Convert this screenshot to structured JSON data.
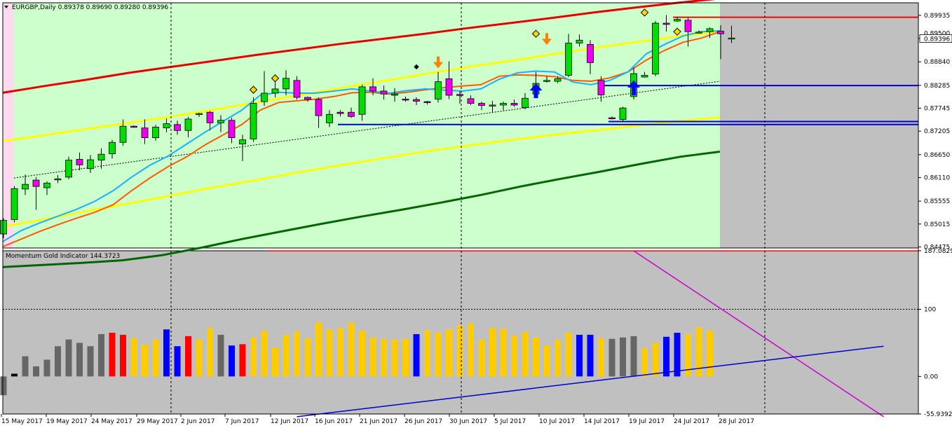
{
  "window": {
    "main_title": "EURGBP,Daily  0.89378 0.89690 0.89280 0.89396",
    "indicator_title": "Momentum Gold Indicator 144.3723",
    "current_price_label": "0.89396",
    "hidden_price_label": "0.89500"
  },
  "colors": {
    "bull": "#00dd00",
    "bear": "#ee00ee",
    "chart_bg": "#ccffcc",
    "future_bg": "#c0c0c0",
    "band": "#e60000",
    "yellow": "#ffff00",
    "green_ma": "#006600",
    "blue_level": "#0000cc",
    "red_level": "#ff0000",
    "ema_fast": "#1ab0ff",
    "ema_slow": "#ff5a00"
  },
  "chart_data": [
    {
      "type": "candlestick",
      "title": "EURGBP,Daily",
      "ylim": [
        0.8445,
        0.9023
      ],
      "y_ticks": [
        "0.89935",
        "0.89390",
        "0.88840",
        "0.88285",
        "0.87745",
        "0.87205",
        "0.86650",
        "0.86110",
        "0.85555",
        "0.85015",
        "0.84475"
      ],
      "x_ticks": [
        "15 May 2017",
        "19 May 2017",
        "24 May 2017",
        "29 May 2017",
        "2 Jun 2017",
        "7 Jun 2017",
        "12 Jun 2017",
        "16 Jun 2017",
        "21 Jun 2017",
        "26 Jun 2017",
        "30 Jun 2017",
        "5 Jul 2017",
        "10 Jul 2017",
        "14 Jul 2017",
        "19 Jul 2017",
        "24 Jul 2017",
        "28 Jul 2017"
      ],
      "ohlc": [
        [
          0.8478,
          0.8515,
          0.8468,
          0.851
        ],
        [
          0.8512,
          0.8591,
          0.8505,
          0.8585
        ],
        [
          0.8584,
          0.8618,
          0.857,
          0.8595
        ],
        [
          0.8605,
          0.8612,
          0.8535,
          0.859
        ],
        [
          0.8587,
          0.8602,
          0.857,
          0.8598
        ],
        [
          0.8608,
          0.8617,
          0.8598,
          0.8608
        ],
        [
          0.8612,
          0.866,
          0.8607,
          0.8652
        ],
        [
          0.8654,
          0.867,
          0.8628,
          0.8641
        ],
        [
          0.8632,
          0.8664,
          0.8622,
          0.8653
        ],
        [
          0.8652,
          0.868,
          0.8632,
          0.8666
        ],
        [
          0.8667,
          0.87,
          0.8656,
          0.8694
        ],
        [
          0.8694,
          0.8748,
          0.8686,
          0.8732
        ],
        [
          0.8732,
          0.8734,
          0.8728,
          0.873
        ],
        [
          0.8728,
          0.8748,
          0.869,
          0.8705
        ],
        [
          0.8705,
          0.8735,
          0.8698,
          0.873
        ],
        [
          0.8728,
          0.875,
          0.8718,
          0.8738
        ],
        [
          0.8736,
          0.8745,
          0.8712,
          0.8722
        ],
        [
          0.8722,
          0.8754,
          0.8706,
          0.8749
        ],
        [
          0.876,
          0.8764,
          0.8754,
          0.8762
        ],
        [
          0.8765,
          0.8768,
          0.8722,
          0.874
        ],
        [
          0.874,
          0.8758,
          0.8718,
          0.8746
        ],
        [
          0.8746,
          0.8752,
          0.8692,
          0.8705
        ],
        [
          0.869,
          0.8712,
          0.865,
          0.87
        ],
        [
          0.8702,
          0.88,
          0.8695,
          0.8786
        ],
        [
          0.879,
          0.8862,
          0.878,
          0.881
        ],
        [
          0.881,
          0.8852,
          0.88,
          0.882
        ],
        [
          0.882,
          0.8864,
          0.8805,
          0.8845
        ],
        [
          0.884,
          0.885,
          0.8795,
          0.88
        ],
        [
          0.88,
          0.8802,
          0.879,
          0.8795
        ],
        [
          0.8795,
          0.88,
          0.8728,
          0.8757
        ],
        [
          0.874,
          0.877,
          0.873,
          0.876
        ],
        [
          0.8765,
          0.877,
          0.8755,
          0.8762
        ],
        [
          0.8765,
          0.8776,
          0.8752,
          0.8755
        ],
        [
          0.876,
          0.883,
          0.8745,
          0.8825
        ],
        [
          0.8825,
          0.8845,
          0.8805,
          0.8815
        ],
        [
          0.8815,
          0.8828,
          0.8795,
          0.8808
        ],
        [
          0.8805,
          0.8822,
          0.879,
          0.8808
        ],
        [
          0.8796,
          0.8802,
          0.879,
          0.8795
        ],
        [
          0.8795,
          0.88,
          0.8782,
          0.8791
        ],
        [
          0.879,
          0.8792,
          0.8783,
          0.8788
        ],
        [
          0.8796,
          0.886,
          0.8788,
          0.8837
        ],
        [
          0.8844,
          0.8885,
          0.8796,
          0.8805
        ],
        [
          0.8807,
          0.8815,
          0.8785,
          0.8805
        ],
        [
          0.8797,
          0.8805,
          0.8782,
          0.8786
        ],
        [
          0.8786,
          0.879,
          0.877,
          0.8781
        ],
        [
          0.878,
          0.8792,
          0.8765,
          0.8782
        ],
        [
          0.8782,
          0.879,
          0.877,
          0.8786
        ],
        [
          0.8786,
          0.8795,
          0.8778,
          0.8782
        ],
        [
          0.8776,
          0.881,
          0.8772,
          0.8798
        ],
        [
          0.8808,
          0.886,
          0.88,
          0.8833
        ],
        [
          0.8838,
          0.885,
          0.8835,
          0.884
        ],
        [
          0.8838,
          0.885,
          0.8834,
          0.8844
        ],
        [
          0.8852,
          0.895,
          0.8848,
          0.8928
        ],
        [
          0.8928,
          0.8948,
          0.892,
          0.8935
        ],
        [
          0.8925,
          0.8935,
          0.8855,
          0.8882
        ],
        [
          0.884,
          0.885,
          0.879,
          0.8806
        ],
        [
          0.8752,
          0.8755,
          0.8748,
          0.8751
        ],
        [
          0.8748,
          0.8778,
          0.8742,
          0.8775
        ],
        [
          0.8802,
          0.887,
          0.8795,
          0.8856
        ],
        [
          0.8848,
          0.886,
          0.8846,
          0.8852
        ],
        [
          0.8855,
          0.898,
          0.885,
          0.8975
        ],
        [
          0.8975,
          0.8994,
          0.8955,
          0.8972
        ],
        [
          0.898,
          0.899,
          0.8978,
          0.8984
        ],
        [
          0.8982,
          0.899,
          0.892,
          0.8955
        ],
        [
          0.8952,
          0.8958,
          0.895,
          0.8954
        ],
        [
          0.8955,
          0.8965,
          0.894,
          0.8962
        ],
        [
          0.8956,
          0.897,
          0.889,
          0.895
        ],
        [
          0.8938,
          0.8969,
          0.8928,
          0.894
        ]
      ],
      "series": [
        {
          "kind": "band_upper",
          "color": "#e60000",
          "values": [
            0.8811,
            0.8827,
            0.8842,
            0.8858,
            0.8872,
            0.8886,
            0.89,
            0.8913,
            0.8926,
            0.8938,
            0.895,
            0.8963,
            0.8975,
            0.8987,
            0.9,
            0.9012,
            0.9023,
            0.9033
          ]
        },
        {
          "kind": "yellow_upper",
          "color": "#ffff00",
          "values": [
            0.8697,
            0.8711,
            0.8726,
            0.874,
            0.8755,
            0.8771,
            0.8788,
            0.8805,
            0.8822,
            0.8838,
            0.8855,
            0.8871,
            0.8886,
            0.8901,
            0.8916,
            0.893,
            0.8944,
            0.8955
          ]
        },
        {
          "kind": "yellow_lower",
          "color": "#ffff00",
          "values": [
            0.8495,
            0.8513,
            0.8532,
            0.855,
            0.8569,
            0.8588,
            0.8605,
            0.8623,
            0.864,
            0.8656,
            0.8672,
            0.8686,
            0.8699,
            0.8711,
            0.8722,
            0.8733,
            0.8744,
            0.8753
          ]
        },
        {
          "kind": "green_ma",
          "color": "#006600",
          "values": [
            0.84,
            0.8405,
            0.841,
            0.8416,
            0.8428,
            0.8446,
            0.8466,
            0.8484,
            0.8502,
            0.8519,
            0.8535,
            0.8552,
            0.857,
            0.859,
            0.8608,
            0.8625,
            0.8643,
            0.866,
            0.8672
          ]
        },
        {
          "kind": "dotted_trend",
          "color": "#000000",
          "values": [
            0.861,
            0.8838
          ]
        },
        {
          "kind": "ema_fast",
          "color": "#1ab0ff",
          "values": [
            0.846,
            0.8486,
            0.8504,
            0.852,
            0.8536,
            0.8555,
            0.858,
            0.8612,
            0.864,
            0.8662,
            0.869,
            0.8718,
            0.8744,
            0.877,
            0.8805,
            0.8812,
            0.881,
            0.881,
            0.8815,
            0.882,
            0.8815,
            0.881,
            0.8816,
            0.882,
            0.8817,
            0.8815,
            0.882,
            0.8843,
            0.8858,
            0.8862,
            0.886,
            0.8836,
            0.883,
            0.884,
            0.886,
            0.8903,
            0.8925,
            0.8945,
            0.8955,
            0.8957
          ]
        },
        {
          "kind": "ema_slow",
          "color": "#ff5a00",
          "values": [
            0.8448,
            0.8466,
            0.8484,
            0.85,
            0.8515,
            0.8529,
            0.8547,
            0.858,
            0.861,
            0.8637,
            0.866,
            0.8688,
            0.8712,
            0.8736,
            0.877,
            0.8788,
            0.8792,
            0.8796,
            0.8802,
            0.8811,
            0.8812,
            0.8808,
            0.8812,
            0.8818,
            0.8823,
            0.8827,
            0.883,
            0.885,
            0.8853,
            0.8852,
            0.8849,
            0.884,
            0.8838,
            0.8846,
            0.886,
            0.8888,
            0.8911,
            0.893,
            0.894,
            0.8955
          ]
        }
      ],
      "levels": [
        {
          "price": 0.8989,
          "color": "#ff0000"
        },
        {
          "price": 0.8828,
          "color": "#0000cc"
        },
        {
          "price": 0.8743,
          "color": "#0000cc"
        },
        {
          "price": 0.8736,
          "color": "#0000cc"
        }
      ],
      "markers": [
        {
          "kind": "diamond",
          "bar": 23,
          "price": 0.8818
        },
        {
          "kind": "diamond",
          "bar": 25,
          "price": 0.8845
        },
        {
          "kind": "diamond_small",
          "bar": 38,
          "price": 0.8872
        },
        {
          "kind": "diamond",
          "bar": 49,
          "price": 0.895
        },
        {
          "kind": "diamond",
          "bar": 59,
          "price": 0.9
        },
        {
          "kind": "diamond",
          "bar": 62,
          "price": 0.8955
        },
        {
          "kind": "arrow_down",
          "bar": 40,
          "price": 0.888
        },
        {
          "kind": "arrow_down",
          "bar": 50,
          "price": 0.8935
        },
        {
          "kind": "arrow_up",
          "bar": 49,
          "price": 0.8818
        },
        {
          "kind": "arrow_up",
          "bar": 58,
          "price": 0.8825
        }
      ]
    },
    {
      "type": "bar",
      "title": "Momentum Gold Indicator 144.3723",
      "ylim": [
        -55.9392,
        187.0829
      ],
      "y_ticks": [
        "187.0829",
        "100",
        "0.00",
        "-55.9392"
      ],
      "values": [
        -28,
        4,
        30,
        15,
        25,
        45,
        55,
        50,
        45,
        63,
        65,
        62,
        57,
        47,
        55,
        70,
        45,
        60,
        55,
        72,
        62,
        46,
        48,
        58,
        68,
        43,
        62,
        67,
        57,
        80,
        70,
        72,
        80,
        68,
        58,
        56,
        55,
        56,
        63,
        69,
        65,
        70,
        76,
        79,
        55,
        72,
        71,
        61,
        66,
        58,
        46,
        55,
        65,
        62,
        62,
        57,
        56,
        58,
        60,
        42,
        50,
        59,
        65,
        63,
        73,
        68
      ],
      "colors": [
        "gray",
        "black",
        "gray",
        "gray",
        "gray",
        "gray",
        "gray",
        "gray",
        "gray",
        "gray",
        "red",
        "red",
        "gold",
        "gold",
        "gold",
        "blue",
        "blue",
        "red",
        "gold",
        "gold",
        "gray",
        "blue",
        "red",
        "gold",
        "gold",
        "gold",
        "gold",
        "gold",
        "gold",
        "gold",
        "gold",
        "gold",
        "gold",
        "gold",
        "gold",
        "gold",
        "gold",
        "gold",
        "blue",
        "gold",
        "gold",
        "gold",
        "gold",
        "gold",
        "gold",
        "gold",
        "gold",
        "gold",
        "gold",
        "gold",
        "gold",
        "gold",
        "gold",
        "blue",
        "blue",
        "gold",
        "gray",
        "gray",
        "gray",
        "gold",
        "gold",
        "blue",
        "blue",
        "gold",
        "gold",
        "gold"
      ],
      "trendlines": [
        {
          "color": "#cc00cc",
          "from": [
            58,
            187
          ],
          "to": [
            81,
            -60
          ]
        },
        {
          "color": "#0000cc",
          "from": [
            27,
            -60
          ],
          "to": [
            81,
            45
          ]
        }
      ],
      "hline_top": 187,
      "hline_dotted": 100
    }
  ]
}
